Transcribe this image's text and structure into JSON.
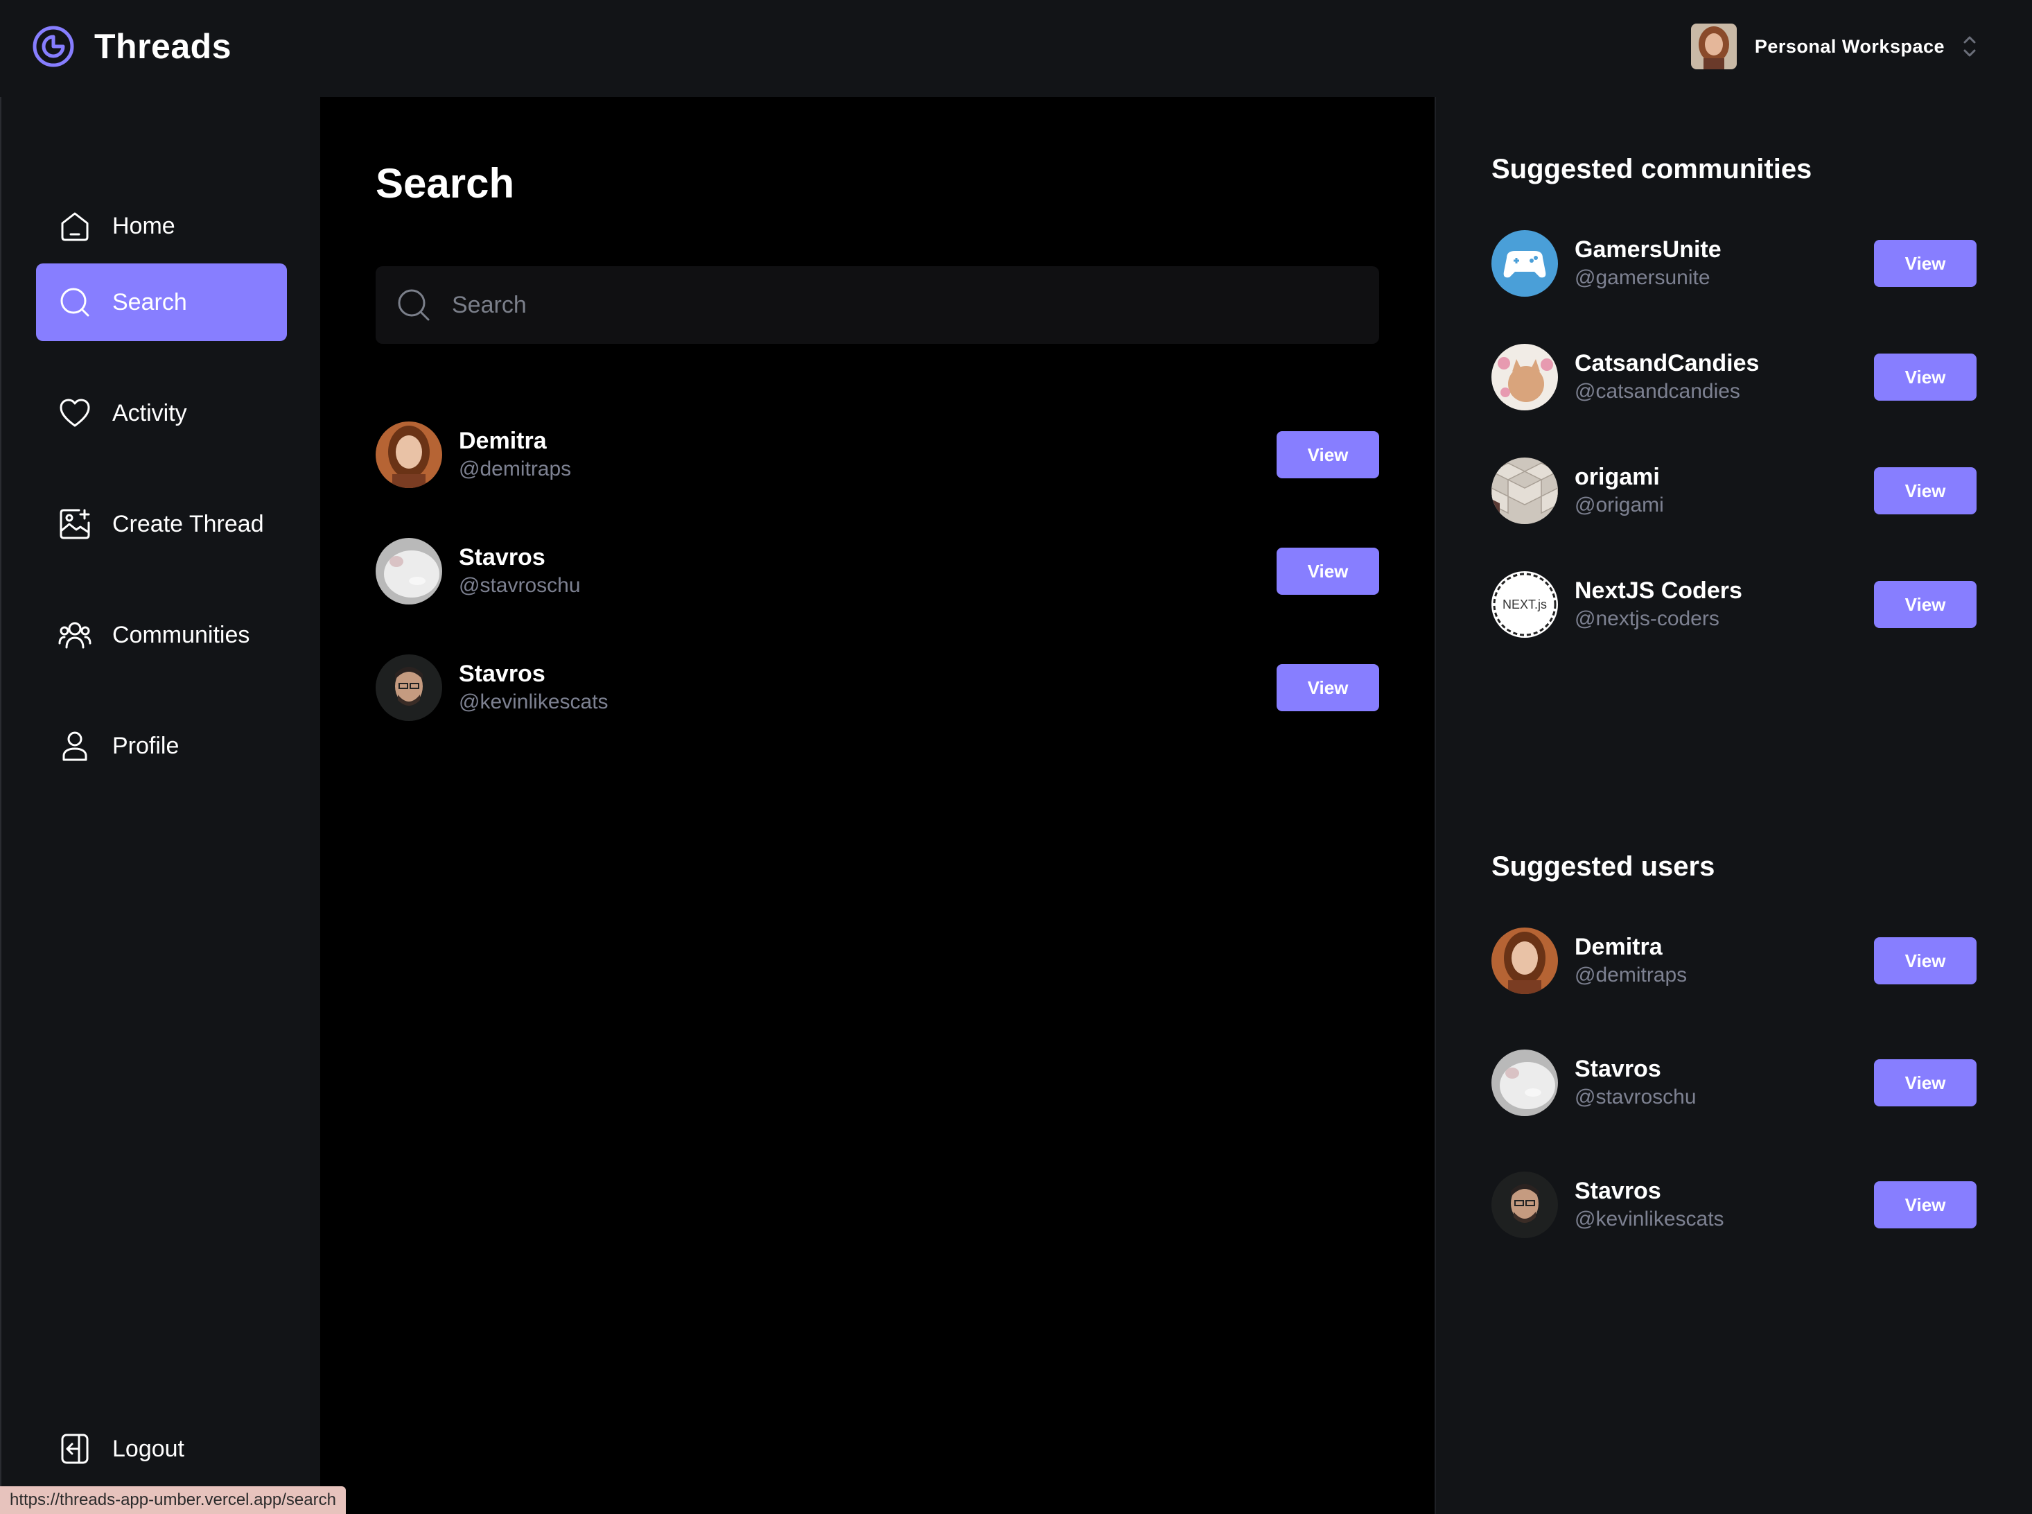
{
  "app": {
    "title": "Threads"
  },
  "workspace": {
    "label": "Personal Workspace"
  },
  "nav": [
    {
      "label": "Home",
      "icon": "home-icon"
    },
    {
      "label": "Search",
      "icon": "search-icon",
      "active": true
    },
    {
      "label": "Activity",
      "icon": "heart-icon"
    },
    {
      "label": "Create Thread",
      "icon": "image-plus-icon"
    },
    {
      "label": "Communities",
      "icon": "users-icon"
    },
    {
      "label": "Profile",
      "icon": "user-icon"
    }
  ],
  "logout": {
    "label": "Logout",
    "icon": "logout-icon"
  },
  "main": {
    "title": "Search",
    "search": {
      "placeholder": "Search",
      "value": ""
    },
    "results": [
      {
        "name": "Demitra",
        "handle": "@demitraps",
        "button": "View",
        "avatar": "woman-portrait"
      },
      {
        "name": "Stavros",
        "handle": "@stavroschu",
        "button": "View",
        "avatar": "white-cat"
      },
      {
        "name": "Stavros",
        "handle": "@kevinlikescats",
        "button": "View",
        "avatar": "man-portrait"
      }
    ]
  },
  "suggested_communities": {
    "title": "Suggested communities",
    "items": [
      {
        "name": "GamersUnite",
        "handle": "@gamersunite",
        "button": "View",
        "avatar": "gamepad"
      },
      {
        "name": "CatsandCandies",
        "handle": "@catsandcandies",
        "button": "View",
        "avatar": "cat-candies"
      },
      {
        "name": "origami",
        "handle": "@origami",
        "button": "View",
        "avatar": "origami-pattern"
      },
      {
        "name": "NextJS Coders",
        "handle": "@nextjs-coders",
        "button": "View",
        "avatar": "nextjs-logo",
        "logo_text": "NEXT.js"
      }
    ]
  },
  "suggested_users": {
    "title": "Suggested users",
    "items": [
      {
        "name": "Demitra",
        "handle": "@demitraps",
        "button": "View",
        "avatar": "woman-portrait"
      },
      {
        "name": "Stavros",
        "handle": "@stavroschu",
        "button": "View",
        "avatar": "white-cat"
      },
      {
        "name": "Stavros",
        "handle": "@kevinlikescats",
        "button": "View",
        "avatar": "man-portrait"
      }
    ]
  },
  "status_url": "https://threads-app-umber.vercel.app/search",
  "colors": {
    "accent": "#877EFF",
    "background": "#121417",
    "main": "#000000",
    "muted": "#7D8191"
  }
}
